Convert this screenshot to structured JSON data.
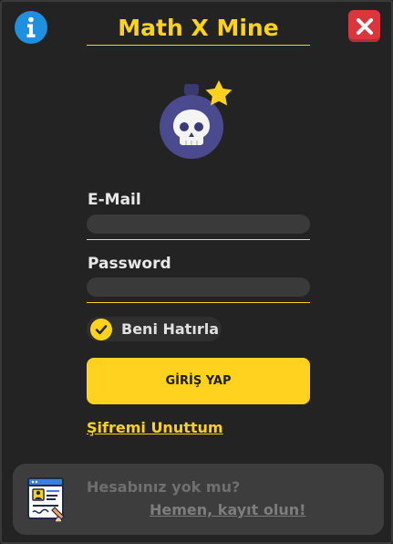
{
  "app": {
    "title": "Math X Mine"
  },
  "header": {
    "info_icon": "info-icon",
    "close_icon": "close-icon"
  },
  "login": {
    "email_label": "E-Mail",
    "email_value": "",
    "password_label": "Password",
    "password_value": "",
    "remember_label": "Beni Hatırla",
    "remember_checked": true,
    "login_button": "GİRİŞ YAP",
    "forgot_link": "Şifremi Unuttum"
  },
  "footer": {
    "question": "Hesabınız yok mu?",
    "register_link": "Hemen, kayıt olun!",
    "icon": "registration-form-icon"
  },
  "colors": {
    "accent": "#ffd21f",
    "background": "#232323",
    "info": "#1f8fe0",
    "close": "#d9363e",
    "bomb": "#4b4a8f"
  }
}
